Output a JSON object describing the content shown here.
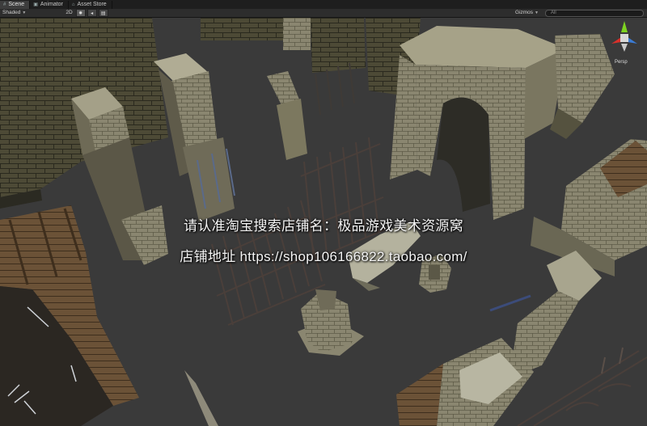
{
  "tabs": [
    {
      "label": "Scene",
      "icon": "scene-icon",
      "active": true
    },
    {
      "label": "Animator",
      "icon": "animator-icon",
      "active": false
    },
    {
      "label": "Asset Store",
      "icon": "asset-store-icon",
      "active": false
    }
  ],
  "toolbar": {
    "shading_mode": "Shaded",
    "toggle_2d": "2D",
    "gizmos_label": "Gizmos",
    "search_placeholder": "All"
  },
  "gizmo": {
    "projection_label": "Persp"
  },
  "watermark": {
    "line1": "请认准淘宝搜索店铺名：极品游戏美术资源窝",
    "line2": "店铺地址 https://shop106166822.taobao.com/"
  },
  "colors": {
    "tab_bar": "#1e1e1e",
    "toolbar": "#2d2d2d",
    "ground": "#3a3a3a",
    "stone": "#8c8a72",
    "wood": "#6b5237",
    "iron": "#4a3f3a",
    "gizmo_x": "#d9302a",
    "gizmo_y": "#7ed321",
    "gizmo_z": "#3a7bd5"
  }
}
